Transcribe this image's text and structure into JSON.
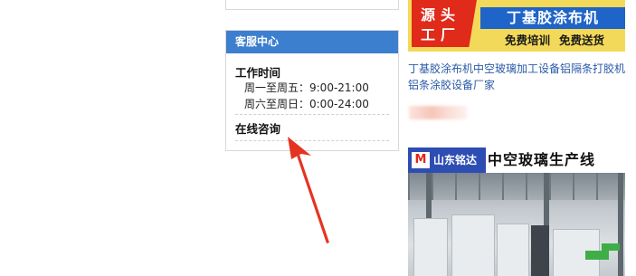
{
  "service_panel": {
    "header": "客服中心",
    "work_time_title": "工作时间",
    "hours": [
      "周一至周五：9:00-21:00",
      "周六至周日：0:00-24:00"
    ],
    "online_consult": "在线咨询"
  },
  "ads": {
    "banner1": {
      "badge": "源头工厂",
      "title": "丁基胶涂布机",
      "sub_left": "免费培训",
      "sub_right": "免费送货"
    },
    "link_text": "丁基胶涂布机中空玻璃加工设备铝隔条打胶机铝条涂胶设备厂家",
    "banner2": {
      "logo_letter": "M",
      "brand": "山东铭达",
      "headline": "中空玻璃生产线"
    }
  },
  "colors": {
    "header_blue": "#3d7fcf",
    "link_blue": "#2a5aa7",
    "arrow_red": "#e53322",
    "badge_red": "#e02a1a",
    "title_blue": "#1f64c8",
    "banner_yellow": "#f3d95a"
  }
}
